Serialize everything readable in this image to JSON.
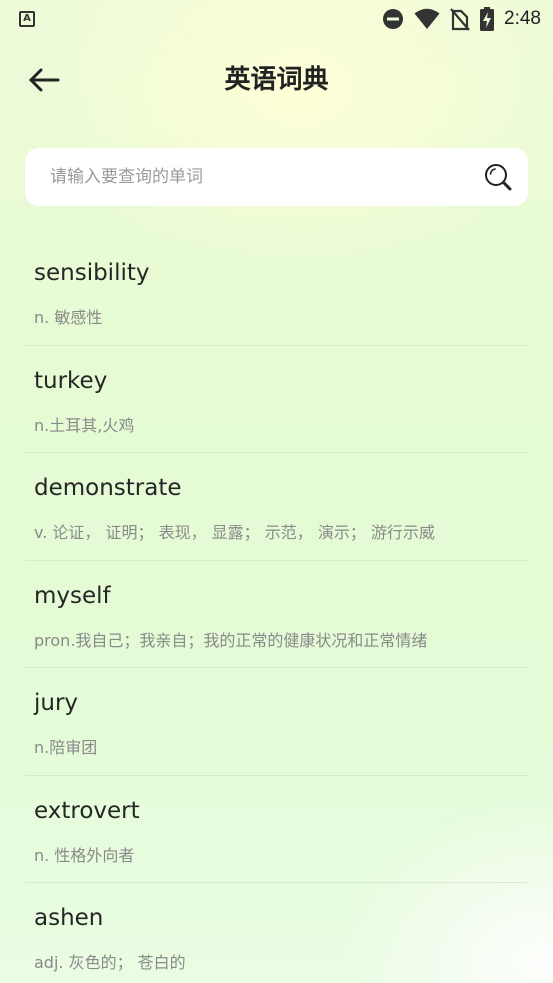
{
  "status_bar": {
    "app_icon_letter": "A",
    "time": "2:48"
  },
  "header": {
    "title": "英语词典"
  },
  "search": {
    "placeholder": "请输入要查询的单词",
    "value": ""
  },
  "words": [
    {
      "word": "sensibility",
      "definition": "n. 敏感性"
    },
    {
      "word": "turkey",
      "definition": "n.土耳其,火鸡"
    },
    {
      "word": "demonstrate",
      "definition": "v. 论证， 证明； 表现， 显露； 示范， 演示； 游行示威"
    },
    {
      "word": "myself",
      "definition": "pron.我自己；我亲自；我的正常的健康状况和正常情绪"
    },
    {
      "word": "jury",
      "definition": "n.陪审团"
    },
    {
      "word": "extrovert",
      "definition": "n. 性格外向者"
    },
    {
      "word": "ashen",
      "definition": "adj. 灰色的； 苍白的"
    }
  ],
  "icons": {
    "back": "arrow-left-icon",
    "search": "search-icon",
    "dnd": "do-not-disturb-icon",
    "wifi": "wifi-icon",
    "no_sim": "no-sim-icon",
    "battery": "battery-charging-icon"
  }
}
